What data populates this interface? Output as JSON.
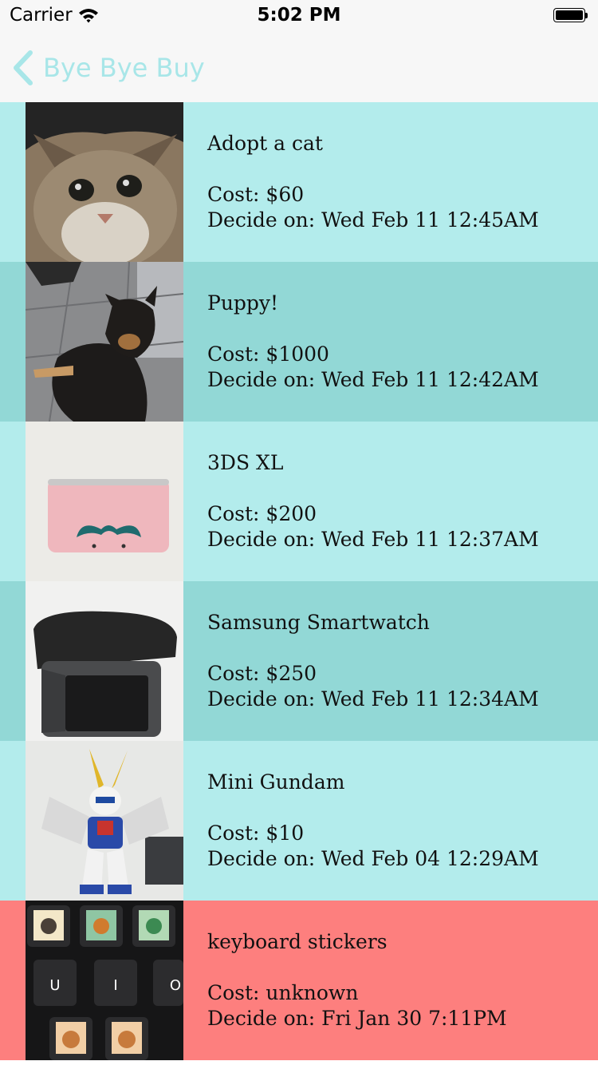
{
  "status_bar": {
    "carrier": "Carrier",
    "time": "5:02 PM"
  },
  "nav": {
    "back_label": "Bye Bye Buy"
  },
  "colors": {
    "row_light": "#b3ecec",
    "row_dark": "#92d8d6",
    "row_alert": "#fd7f7e",
    "accent": "#a8e6e8"
  },
  "items": [
    {
      "name": "Adopt a cat",
      "cost": "Cost: $60",
      "decide": "Decide on: Wed Feb 11 12:45AM",
      "photo": "cat-photo"
    },
    {
      "name": "Puppy!",
      "cost": "Cost: $1000",
      "decide": "Decide on: Wed Feb 11 12:42AM",
      "photo": "dog-photo"
    },
    {
      "name": "3DS XL",
      "cost": "Cost: $200",
      "decide": "Decide on: Wed Feb 11 12:37AM",
      "photo": "3ds-photo"
    },
    {
      "name": "Samsung Smartwatch",
      "cost": "Cost: $250",
      "decide": "Decide on: Wed Feb 11 12:34AM",
      "photo": "smartwatch-photo"
    },
    {
      "name": "Mini Gundam",
      "cost": "Cost: $10",
      "decide": "Decide on: Wed Feb 04 12:29AM",
      "photo": "gundam-photo"
    },
    {
      "name": "keyboard stickers",
      "cost": "Cost: unknown",
      "decide": "Decide on: Fri Jan 30 7:11PM",
      "photo": "keyboard-photo"
    }
  ]
}
